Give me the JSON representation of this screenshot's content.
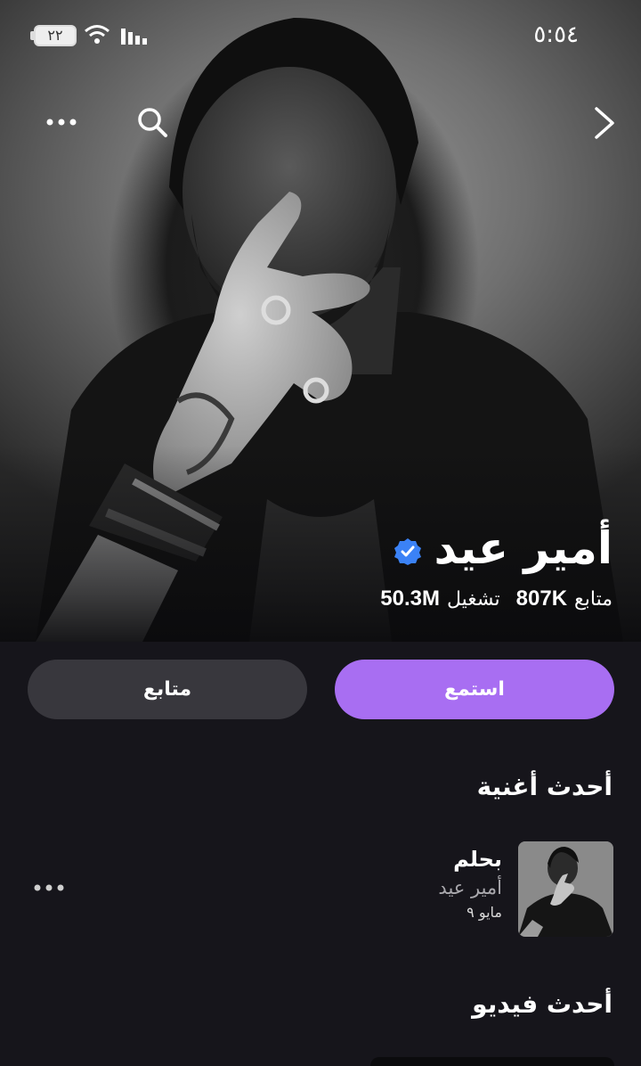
{
  "status_bar": {
    "time": "٥:٥٤",
    "battery_level": "٢٢",
    "icons": [
      "battery-icon",
      "wifi-icon",
      "signal-icon"
    ]
  },
  "nav": {
    "icons": [
      "more-horizontal-icon",
      "search-icon",
      "chevron-right-icon"
    ]
  },
  "artist": {
    "name": "أمير عيد",
    "verified": true,
    "followers_count": "807K",
    "followers_label": "متابع",
    "plays_count": "50.3M",
    "plays_label": "تشغيل"
  },
  "buttons": {
    "listen_label": "استمع",
    "follow_label": "متابع"
  },
  "latest_song": {
    "section_title": "أحدث أغنية",
    "title": "بحلم",
    "artist": "أمير عيد",
    "date": "مايو ٩"
  },
  "latest_video": {
    "section_title": "أحدث فيديو"
  },
  "colors": {
    "background": "#16151b",
    "accent": "#a86ef2",
    "secondary_button": "#38373d",
    "verified": "#3b82f6",
    "muted_text": "#a9a8ad"
  }
}
